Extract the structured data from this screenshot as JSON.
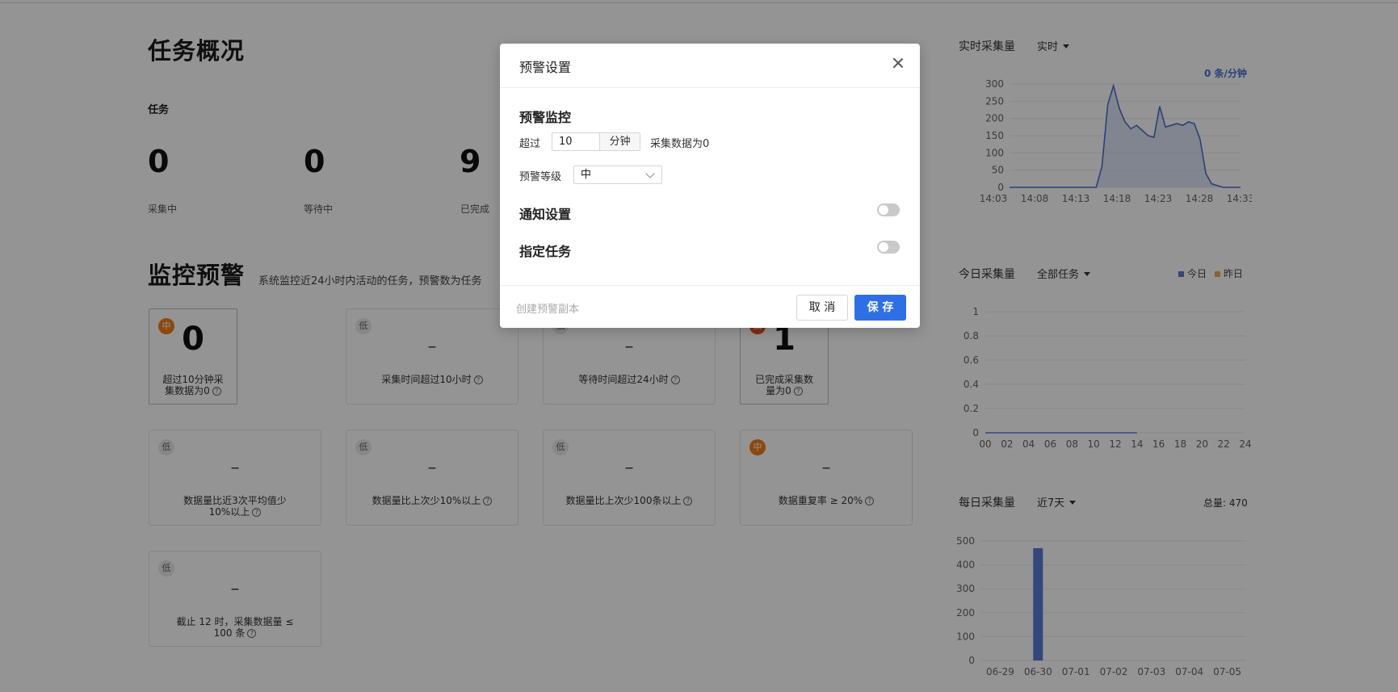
{
  "overview": {
    "title": "任务概况",
    "task_label": "任务",
    "stats": [
      {
        "value": "0",
        "label": "采集中"
      },
      {
        "value": "0",
        "label": "等待中"
      },
      {
        "value": "9",
        "label": "已完成"
      }
    ]
  },
  "monitor": {
    "title": "监控预警",
    "subtitle": "系统监控近24小时内活动的任务，预警数为任务",
    "help_icon": "question-circle-icon",
    "cards": [
      {
        "badge": "中",
        "level": "mid",
        "value": "0",
        "desc": "超过10分钟采集数据为0"
      },
      {
        "badge": "低",
        "level": "low",
        "value": "–",
        "desc": "采集时间超过10小时"
      },
      {
        "badge": "低",
        "level": "low",
        "value": "–",
        "desc": "等待时间超过24小时"
      },
      {
        "badge": "高",
        "level": "high",
        "value": "1",
        "desc": "已完成采集数量为0"
      },
      {
        "badge": "低",
        "level": "low",
        "value": "–",
        "desc": "数据量比近3次平均值少10%以上"
      },
      {
        "badge": "低",
        "level": "low",
        "value": "–",
        "desc": "数据量比上次少10%以上"
      },
      {
        "badge": "低",
        "level": "low",
        "value": "–",
        "desc": "数据量比上次少100条以上"
      },
      {
        "badge": "中",
        "level": "mid",
        "value": "–",
        "desc": "数据重复率 ≥ 20%"
      },
      {
        "badge": "低",
        "level": "low",
        "value": "–",
        "desc": "截止 12 时，采集数据量 ≤ 100 条"
      }
    ]
  },
  "realtime": {
    "title": "实时采集量",
    "select": "实时",
    "rate": "0 条/分钟",
    "color": "#4a6fd0"
  },
  "today": {
    "title": "今日采集量",
    "select": "全部任务",
    "legend": [
      {
        "name": "今日",
        "color": "#5b7bd5"
      },
      {
        "name": "昨日",
        "color": "#f0a860"
      }
    ]
  },
  "daily": {
    "title": "每日采集量",
    "select": "近7天",
    "total": "总量: 470"
  },
  "chart_data": [
    {
      "type": "area",
      "x": [
        "14:03",
        "14:08",
        "14:13",
        "14:18",
        "14:23",
        "14:28",
        "14:33"
      ],
      "series": [
        {
          "values": [
            0,
            0,
            0,
            0,
            0,
            0,
            0,
            0,
            0,
            0,
            0,
            0,
            0,
            0,
            0,
            0,
            60,
            240,
            295,
            230,
            190,
            170,
            180,
            165,
            150,
            145,
            235,
            175,
            180,
            185,
            180,
            190,
            185,
            140,
            40,
            10,
            5,
            0,
            0,
            0,
            0
          ]
        }
      ],
      "y_ticks": [
        "0",
        "50",
        "100",
        "150",
        "200",
        "250",
        "300"
      ],
      "ylim": [
        0,
        300
      ],
      "grid": true
    },
    {
      "type": "line",
      "x": [
        "00",
        "02",
        "04",
        "06",
        "08",
        "10",
        "12",
        "14",
        "16",
        "18",
        "20",
        "22",
        "24"
      ],
      "series": [
        {
          "name": "今日",
          "values": [
            0,
            0,
            0,
            0,
            0,
            0,
            0,
            0,
            0,
            0,
            0,
            0,
            0,
            0,
            0
          ]
        }
      ],
      "y_ticks": [
        "0",
        "0.2",
        "0.4",
        "0.6",
        "0.8",
        "1"
      ],
      "ylim": [
        0,
        1
      ],
      "legend": "top-right",
      "grid": true
    },
    {
      "type": "bar",
      "categories": [
        "06-29",
        "06-30",
        "07-01",
        "07-02",
        "07-03",
        "07-04",
        "07-05"
      ],
      "values": [
        0,
        470,
        0,
        0,
        0,
        0,
        0
      ],
      "y_ticks": [
        "0",
        "100",
        "200",
        "300",
        "400",
        "500"
      ],
      "ylim": [
        0,
        500
      ],
      "grid": true
    }
  ],
  "modal": {
    "title": "预警设置",
    "section_monitor": "预警监控",
    "exceed_label": "超过",
    "minutes_value": "10",
    "minutes_unit": "分钟",
    "exceed_suffix": "采集数据为0",
    "level_label": "预警等级",
    "level_value": "中",
    "section_notify": "通知设置",
    "section_assign": "指定任务",
    "create_copy": "创建预警副本",
    "cancel": "取 消",
    "save": "保 存"
  }
}
